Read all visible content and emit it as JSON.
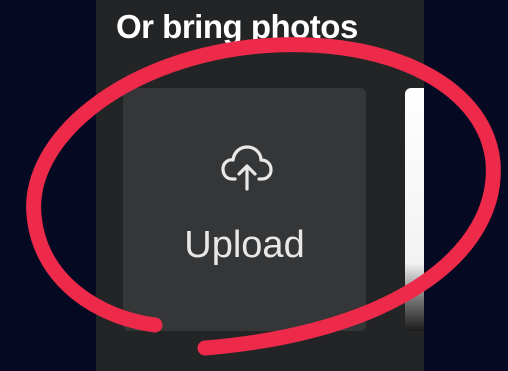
{
  "panel": {
    "heading": "Or bring photos"
  },
  "upload_tile": {
    "label": "Upload",
    "icon": "cloud-upload-icon"
  },
  "thumbnail": {
    "description": ""
  },
  "annotation": {
    "shape": "hand-drawn-circle",
    "color": "#ee2a4a"
  },
  "colors": {
    "background": "#050a22",
    "panel": "#222426",
    "tile": "#343638",
    "text": "#ffffff"
  }
}
